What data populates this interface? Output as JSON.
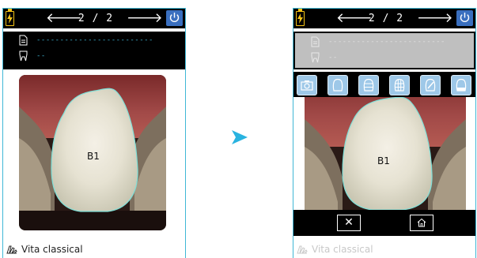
{
  "colors": {
    "accent": "#3fb7d6",
    "power_button": "#3a6fbf",
    "battery": "#f5c518",
    "tool_button": "#9ec8e8"
  },
  "screen1": {
    "pager": "2 / 2",
    "info": {
      "doc_text": "-------------------------",
      "tooth_text": "--"
    },
    "shade_label": "B1",
    "footer_label": "Vita classical"
  },
  "screen2": {
    "pager": "2 / 2",
    "info": {
      "doc_text": "-------------------------",
      "tooth_text": "--"
    },
    "toolbar_icons": [
      "camera-icon",
      "tooth-outline-icon",
      "tooth-thirds-icon",
      "tooth-grid-icon",
      "tooth-edit-icon",
      "tooth-incisal-icon"
    ],
    "shade_label": "B1",
    "bottom_buttons": {
      "close_symbol": "✕",
      "home_icon": "home-icon"
    },
    "footer_label": "Vita classical"
  },
  "transition_icon": "arrow-right-icon"
}
